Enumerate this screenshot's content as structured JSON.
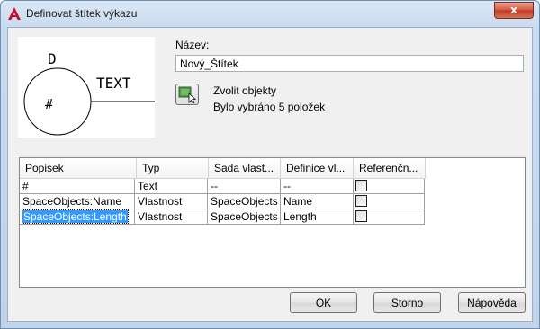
{
  "window": {
    "title": "Definovat štítek výkazu",
    "close_glyph": "x"
  },
  "preview": {
    "label_top": "D",
    "label_right": "TEXT",
    "label_center": "#"
  },
  "form": {
    "name_label": "Název:",
    "name_value": "Nový_Štítek",
    "pick_objects_label": "Zvolit objekty",
    "selection_status": "Bylo vybráno 5 položek"
  },
  "table": {
    "columns": [
      "Popisek",
      "Typ",
      "Sada vlast...",
      "Definice vl...",
      "Referenčn..."
    ],
    "rows": [
      {
        "label": "#",
        "type": "Text",
        "set": "--",
        "def": "--",
        "ref": false
      },
      {
        "label": "SpaceObjects:Name",
        "type": "Vlastnost",
        "set": "SpaceObjects",
        "def": "Name",
        "ref": false
      },
      {
        "label": "SpaceObjects:Length",
        "type": "Vlastnost",
        "set": "SpaceObjects",
        "def": "Length",
        "ref": false
      }
    ],
    "selected_row": 2
  },
  "buttons": {
    "ok": "OK",
    "cancel": "Storno",
    "help": "Nápověda"
  },
  "colors": {
    "selection": "#3399ff",
    "close_button": "#c94a30",
    "app_icon": "#c8102e"
  },
  "icons": {
    "app": "autocad-a-icon",
    "pick": "select-objects-icon",
    "close": "close-icon"
  }
}
